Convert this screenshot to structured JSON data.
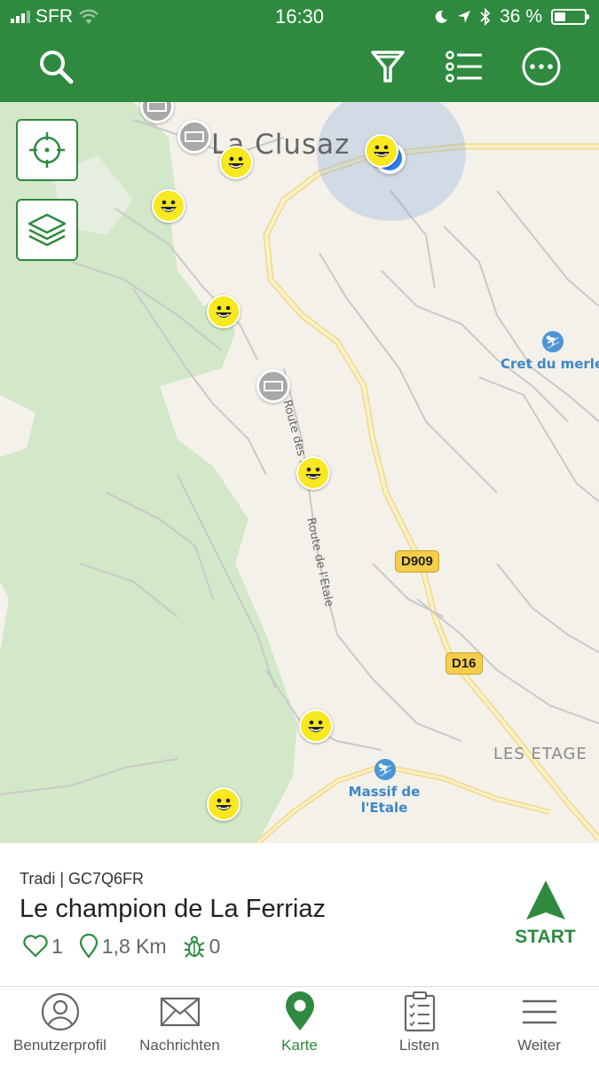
{
  "status_bar": {
    "carrier": "SFR",
    "time": "16:30",
    "battery": "36 %",
    "battery_level": 0.36
  },
  "header": {
    "icons": [
      "search-icon",
      "filter-icon",
      "list-icon",
      "more-icon"
    ]
  },
  "map": {
    "place_labels": {
      "town": "La Clusaz",
      "cret": "Cret du merle",
      "les_etages": "LES ETAGE",
      "massif_line1": "Massif de",
      "massif_line2": "l'Etale"
    },
    "street_labels": {
      "route_fiaux": "Route des Fiaux",
      "route_etale": "Route de l'Etale"
    },
    "road_badges": {
      "d909": "D909",
      "d16": "D16"
    },
    "colors": {
      "land": "#f4f1ea",
      "forest": "#d2e8c9",
      "accent_green": "#2f8a3f",
      "location_blue": "#2b7ef2",
      "road_yellow": "#f5cd4b",
      "cache_yellow": "#f7e81f"
    }
  },
  "cache_detail": {
    "type_code": "Tradi | GC7Q6FR",
    "name": "Le champion de La Ferriaz",
    "favorites": "1",
    "distance": "1,8 Km",
    "bugs": "0",
    "start_label": "START"
  },
  "tab_bar": {
    "tabs": [
      {
        "label": "Benutzerprofil",
        "icon": "profile-icon"
      },
      {
        "label": "Nachrichten",
        "icon": "mail-icon"
      },
      {
        "label": "Karte",
        "icon": "map-pin-icon"
      },
      {
        "label": "Listen",
        "icon": "checklist-icon"
      },
      {
        "label": "Weiter",
        "icon": "menu-icon"
      }
    ],
    "active": "Karte"
  }
}
